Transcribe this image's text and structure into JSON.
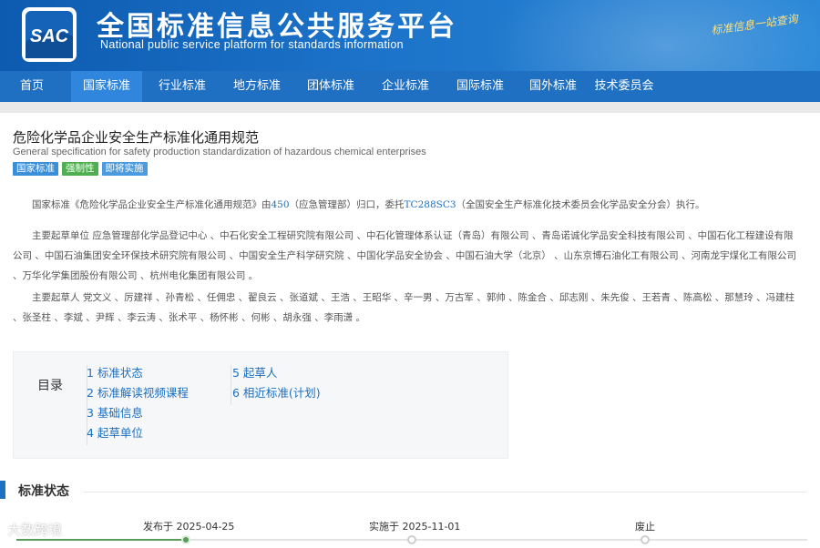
{
  "header": {
    "logo_text": "SAC",
    "title_cn": "全国标准信息公共服务平台",
    "title_en": "National public service platform  for standards information",
    "slogan": "标准信息一站查询"
  },
  "nav": {
    "items": [
      {
        "label": "首页"
      },
      {
        "label": "国家标准"
      },
      {
        "label": "行业标准"
      },
      {
        "label": "地方标准"
      },
      {
        "label": "团体标准"
      },
      {
        "label": "企业标准"
      },
      {
        "label": "国际标准"
      },
      {
        "label": "国外标准"
      },
      {
        "label": "技术委员会"
      }
    ],
    "active_index": 1
  },
  "standard": {
    "title_cn": "危险化学品企业安全生产标准化通用规范",
    "title_en": "General specification for safety production standardization of hazardous chemical enterprises",
    "badges": [
      "国家标准",
      "强制性",
      "即将实施"
    ]
  },
  "description": {
    "p1_prefix": "国家标准《危险化学品企业安全生产标准化通用规范》由",
    "p1_link1": "450",
    "p1_mid": "（应急管理部）归口，委托",
    "p1_link2": "TC288SC3",
    "p1_suffix": "（全国安全生产标准化技术委员会化学品安全分会）执行。",
    "p2": "主要起草单位 应急管理部化学品登记中心 、中石化安全工程研究院有限公司 、中石化管理体系认证（青岛）有限公司 、青岛诺诚化学品安全科技有限公司 、中国石化工程建设有限公司 、中国石油集团安全环保技术研究院有限公司 、中国安全生产科学研究院 、中国化学品安全协会 、中国石油大学（北京） 、山东京博石油化工有限公司 、河南龙宇煤化工有限公司 、万华化学集团股份有限公司 、杭州电化集团有限公司 。",
    "p3": "主要起草人 党文义 、厉建祥 、孙青松 、任佣忠 、翟良云 、张道斌 、王浩 、王昭华 、辛一男 、万古军 、郭帅 、陈金合 、邱志刚 、朱先俊 、王若青 、陈高松 、那慧玲 、冯建柱 、张圣柱 、李斌 、尹辉 、李云涛 、张术平 、杨怀彬 、何彬 、胡永强 、李雨潇 。"
  },
  "toc": {
    "label": "目录",
    "col1": [
      "1  标准状态",
      "2  标准解读视频课程",
      "3  基础信息",
      "4  起草单位"
    ],
    "col2": [
      "5  起草人",
      "6  相近标准(计划)"
    ]
  },
  "status_section": {
    "title": "标准状态",
    "timeline": [
      {
        "label": "发布于 2025-04-25",
        "state": "done"
      },
      {
        "label": "实施于 2025-11-01",
        "state": "pending"
      },
      {
        "label": "废止",
        "state": "pending"
      }
    ]
  },
  "watermark": "大数跨境",
  "colors": {
    "primary": "#1f6fc2",
    "active_nav": "#2f86dc",
    "link": "#1a6fc0",
    "timeline_done": "#5a9a5a"
  }
}
